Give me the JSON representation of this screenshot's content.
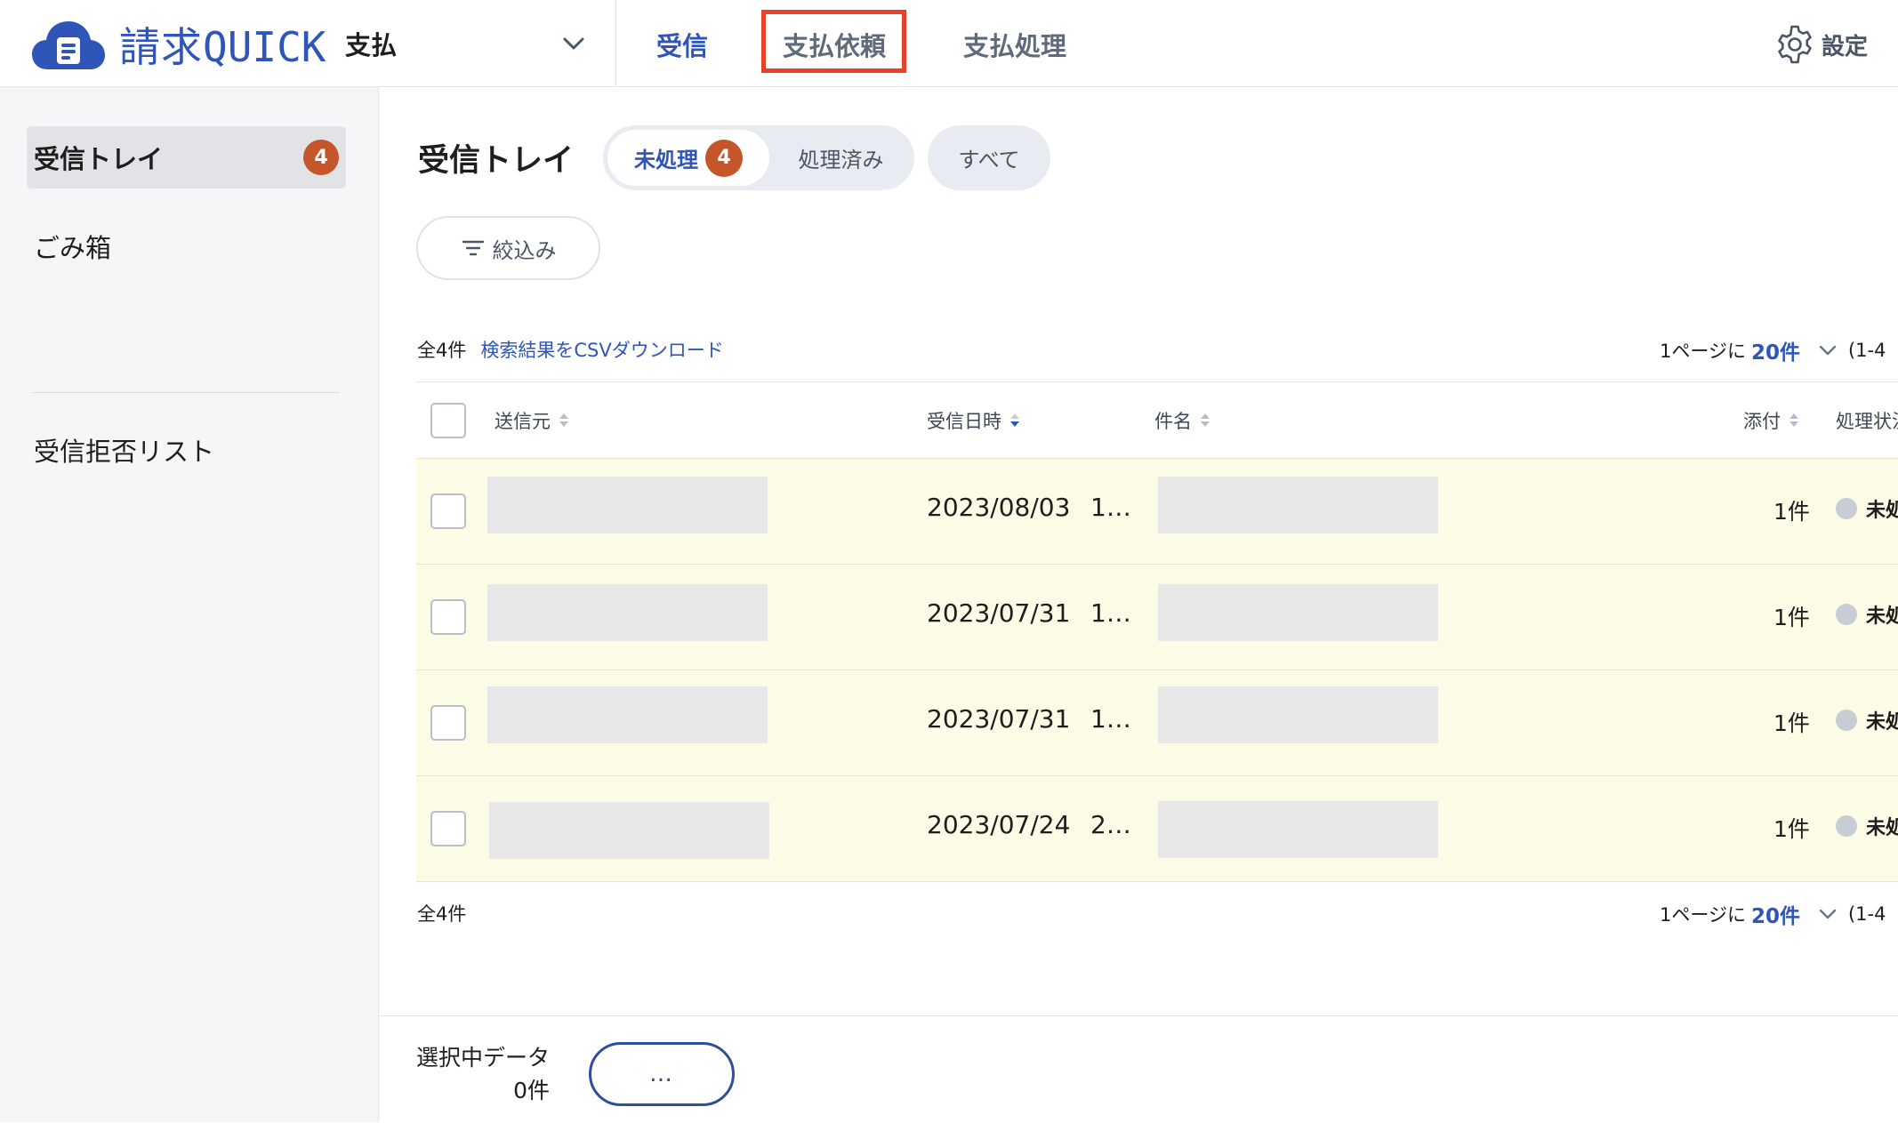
{
  "brand": {
    "name_kanji": "請求",
    "name_latin": "QUICK",
    "color": "#2f55b8"
  },
  "header": {
    "mode_label": "支払",
    "tabs": [
      {
        "label": "受信",
        "state": "active"
      },
      {
        "label": "支払依頼",
        "state": "highlighted"
      },
      {
        "label": "支払処理",
        "state": "inactive"
      }
    ],
    "settings_label": "設定",
    "highlight_color": "#e8422a"
  },
  "sidebar": {
    "items": [
      {
        "label": "受信トレイ",
        "badge": "4",
        "active": true
      },
      {
        "label": "ごみ箱"
      },
      {
        "label": "受信拒否リスト"
      }
    ]
  },
  "main": {
    "title": "受信トレイ",
    "segments": [
      {
        "label": "未処理",
        "badge": "4",
        "selected": true
      },
      {
        "label": "処理済み"
      }
    ],
    "all_label": "すべて",
    "filter_label": "絞込み",
    "total_count": "全4件",
    "csv_link": "検索結果をCSVダウンロード",
    "per_page_prefix": "1ページに",
    "per_page_value": "20件",
    "range_text": "(1-4",
    "columns": {
      "sender": "送信元",
      "received_at": "受信日時",
      "subject": "件名",
      "attachments": "添付",
      "status": "処理状況"
    },
    "rows": [
      {
        "date": "2023/08/03",
        "time": "1…",
        "attachments": "1件",
        "status": "未処理"
      },
      {
        "date": "2023/07/31",
        "time": "1…",
        "attachments": "1件",
        "status": "未処理"
      },
      {
        "date": "2023/07/31",
        "time": "1…",
        "attachments": "1件",
        "status": "未処理"
      },
      {
        "date": "2023/07/24",
        "time": "2…",
        "attachments": "1件",
        "status": "未処理"
      }
    ],
    "badge_color": "#c4562a",
    "row_highlight_color": "#fcfbe6"
  },
  "footer": {
    "selected_label": "選択中データ",
    "selected_count": "0件",
    "more_label": "…"
  }
}
